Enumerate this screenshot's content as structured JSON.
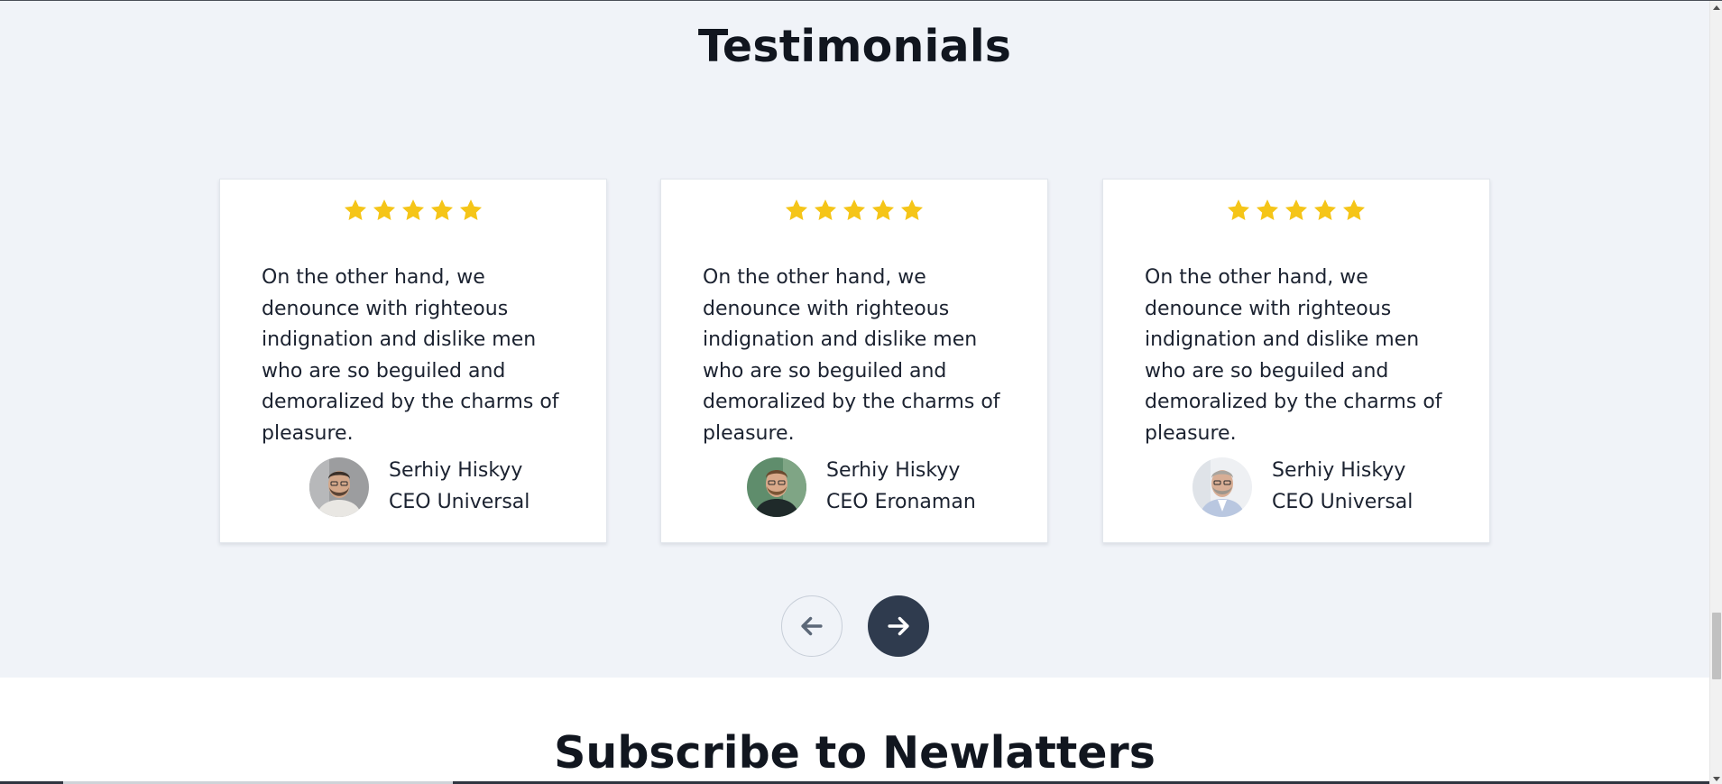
{
  "testimonials": {
    "title": "Testimonials",
    "rating_stars": 5,
    "cards": [
      {
        "rating": 5,
        "quote": "On the other hand, we denounce with righteous indignation and dislike men who are so beguiled and demoralized by the charms of pleasure.",
        "name": "Serhiy Hiskyy",
        "role": "CEO Universal"
      },
      {
        "rating": 5,
        "quote": "On the other hand, we denounce with righteous indignation and dislike men who are so beguiled and demoralized by the charms of pleasure.",
        "name": "Serhiy Hiskyy",
        "role": "CEO Eronaman"
      },
      {
        "rating": 5,
        "quote": "On the other hand, we denounce with righteous indignation and dislike men who are so beguiled and demoralized by the charms of pleasure.",
        "name": "Serhiy Hiskyy",
        "role": "CEO Universal"
      }
    ],
    "nav": {
      "prev_icon": "arrow-left-icon",
      "next_icon": "arrow-right-icon"
    }
  },
  "subscribe": {
    "title": "Subscribe to Newlatters"
  },
  "colors": {
    "section_bg": "#f0f3f8",
    "star": "#f5c518",
    "next_button": "#2f3b4e",
    "text": "#1b2230"
  }
}
